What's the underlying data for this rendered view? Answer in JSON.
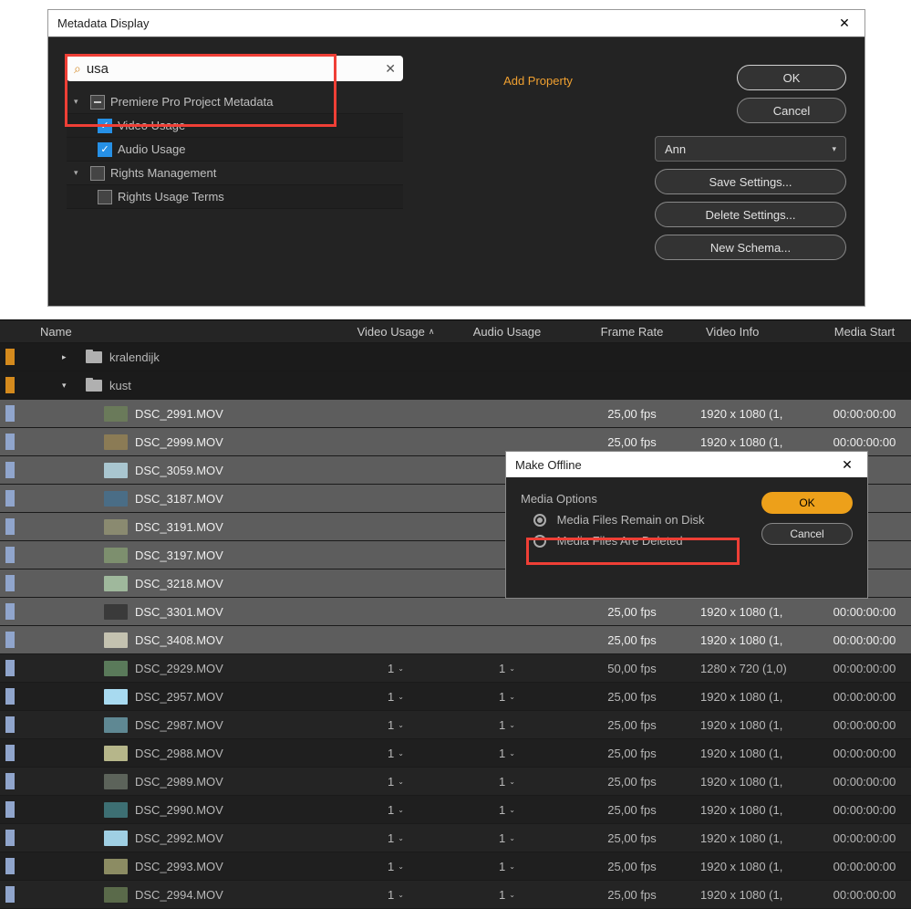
{
  "meta": {
    "title": "Metadata Display",
    "close": "✕",
    "search": {
      "placeholder": "",
      "value": "usa",
      "clear": "✕"
    },
    "addprop": "Add Property",
    "tree": {
      "group1": "Premiere Pro Project Metadata",
      "item1": "Video Usage",
      "item2": "Audio Usage",
      "group2": "Rights Management",
      "item3": "Rights Usage Terms"
    },
    "btns": {
      "ok": "OK",
      "cancel": "Cancel",
      "save": "Save Settings...",
      "delete": "Delete Settings...",
      "schema": "New Schema..."
    },
    "select": "Ann"
  },
  "panel": {
    "cols": {
      "name": "Name",
      "vid": "Video Usage",
      "aud": "Audio Usage",
      "fr": "Frame Rate",
      "vi": "Video Info",
      "ms": "Media Start"
    },
    "folder1": "kralendijk",
    "folder2": "kust",
    "rows": [
      {
        "n": "DSC_2991.MOV",
        "v": "",
        "a": "",
        "fr": "25,00 fps",
        "vi": "1920 x 1080 (1,",
        "ms": "00:00:00:00",
        "sel": true,
        "c": "#6a7a5a"
      },
      {
        "n": "DSC_2999.MOV",
        "v": "",
        "a": "",
        "fr": "25,00 fps",
        "vi": "1920 x 1080 (1,",
        "ms": "00:00:00:00",
        "sel": true,
        "c": "#8b7b55"
      },
      {
        "n": "DSC_3059.MOV",
        "v": "",
        "a": "",
        "fr": "",
        "vi": "",
        "ms": "",
        "sel": true,
        "c": "#a9c6d0"
      },
      {
        "n": "DSC_3187.MOV",
        "v": "",
        "a": "",
        "fr": "",
        "vi": "",
        "ms": "",
        "sel": true,
        "c": "#4a6d86"
      },
      {
        "n": "DSC_3191.MOV",
        "v": "",
        "a": "",
        "fr": "",
        "vi": "",
        "ms": "",
        "sel": true,
        "c": "#8a8a70"
      },
      {
        "n": "DSC_3197.MOV",
        "v": "",
        "a": "",
        "fr": "",
        "vi": "",
        "ms": "",
        "sel": true,
        "c": "#7d8f6e"
      },
      {
        "n": "DSC_3218.MOV",
        "v": "",
        "a": "",
        "fr": "",
        "vi": "",
        "ms": "",
        "sel": true,
        "c": "#9fb89c"
      },
      {
        "n": "DSC_3301.MOV",
        "v": "",
        "a": "",
        "fr": "25,00 fps",
        "vi": "1920 x 1080 (1,",
        "ms": "00:00:00:00",
        "sel": true,
        "c": "#3a3a3a"
      },
      {
        "n": "DSC_3408.MOV",
        "v": "",
        "a": "",
        "fr": "25,00 fps",
        "vi": "1920 x 1080 (1,",
        "ms": "00:00:00:00",
        "sel": true,
        "c": "#c4c2b0"
      },
      {
        "n": "DSC_2929.MOV",
        "v": "1",
        "a": "1",
        "fr": "50,00 fps",
        "vi": "1280 x 720 (1,0)",
        "ms": "00:00:00:00",
        "sel": false,
        "c": "#5a7a5a"
      },
      {
        "n": "DSC_2957.MOV",
        "v": "1",
        "a": "1",
        "fr": "25,00 fps",
        "vi": "1920 x 1080 (1,",
        "ms": "00:00:00:00",
        "sel": false,
        "c": "#a8daf0"
      },
      {
        "n": "DSC_2987.MOV",
        "v": "1",
        "a": "1",
        "fr": "25,00 fps",
        "vi": "1920 x 1080 (1,",
        "ms": "00:00:00:00",
        "sel": false,
        "c": "#5f8893"
      },
      {
        "n": "DSC_2988.MOV",
        "v": "1",
        "a": "1",
        "fr": "25,00 fps",
        "vi": "1920 x 1080 (1,",
        "ms": "00:00:00:00",
        "sel": false,
        "c": "#b6b68a"
      },
      {
        "n": "DSC_2989.MOV",
        "v": "1",
        "a": "1",
        "fr": "25,00 fps",
        "vi": "1920 x 1080 (1,",
        "ms": "00:00:00:00",
        "sel": false,
        "c": "#5c635a"
      },
      {
        "n": "DSC_2990.MOV",
        "v": "1",
        "a": "1",
        "fr": "25,00 fps",
        "vi": "1920 x 1080 (1,",
        "ms": "00:00:00:00",
        "sel": false,
        "c": "#3d6f73"
      },
      {
        "n": "DSC_2992.MOV",
        "v": "1",
        "a": "1",
        "fr": "25,00 fps",
        "vi": "1920 x 1080 (1,",
        "ms": "00:00:00:00",
        "sel": false,
        "c": "#9fcfe3"
      },
      {
        "n": "DSC_2993.MOV",
        "v": "1",
        "a": "1",
        "fr": "25,00 fps",
        "vi": "1920 x 1080 (1,",
        "ms": "00:00:00:00",
        "sel": false,
        "c": "#8c8c63"
      },
      {
        "n": "DSC_2994.MOV",
        "v": "1",
        "a": "1",
        "fr": "25,00 fps",
        "vi": "1920 x 1080 (1,",
        "ms": "00:00:00:00",
        "sel": false,
        "c": "#5a6a4a"
      }
    ]
  },
  "mo": {
    "title": "Make Offline",
    "close": "✕",
    "heading": "Media Options",
    "opt1": "Media Files Remain on Disk",
    "opt2": "Media Files Are Deleted",
    "ok": "OK",
    "cancel": "Cancel"
  }
}
